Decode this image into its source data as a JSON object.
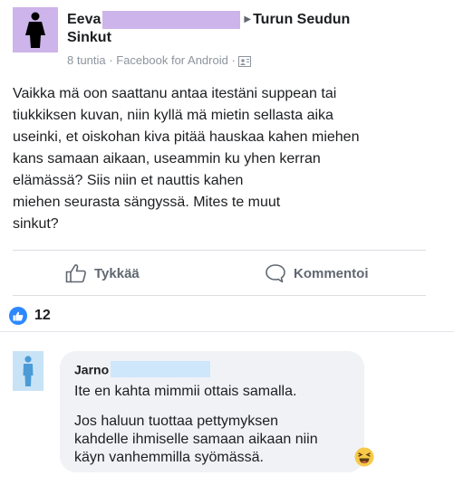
{
  "post": {
    "author_name": "Eeva",
    "group_name": "Turun Seudun",
    "group_name_line2": "Sinkut",
    "time": "8 tuntia",
    "meta_sep": "·",
    "source": "Facebook for Android",
    "meta_sep2": "·",
    "text": "Vaikka mä oon saattanu antaa itestäni suppean tai\ntiukkiksen kuvan, niin kyllä mä mietin sellasta aika\nuseinki, et oiskohan kiva pitää hauskaa kahen miehen\nkans samaan aikaan, useammin ku yhen kerran\nelämässä? Siis niin et  nauttis kahen\nmiehen seurasta sängyssä. Mites te muut\nsinkut?"
  },
  "actions": {
    "like_label": "Tykkää",
    "comment_label": "Kommentoi"
  },
  "reactions": {
    "count": "12"
  },
  "comment": {
    "author_name": "Jarno",
    "text1": "Ite en kahta mimmii ottais samalla.",
    "text2": "Jos haluun tuottaa pettymyksen\nkahdelle ihmiselle samaan aikaan niin\nkäyn vanhemmilla syömässä."
  },
  "colors": {
    "like_blue": "#2d88ff",
    "redaction_purple": "#cdb4ea",
    "redaction_blue": "#cfe7fb",
    "bubble_bg": "#f0f2f5"
  },
  "icons": {
    "post_avatar": "person-icon",
    "audience": "audience-icon",
    "like": "thumbs-up-icon",
    "comment": "comment-icon",
    "reaction": "like-reaction-icon",
    "comment_avatar": "person-icon",
    "emoji": "laughing-emoji-icon"
  }
}
